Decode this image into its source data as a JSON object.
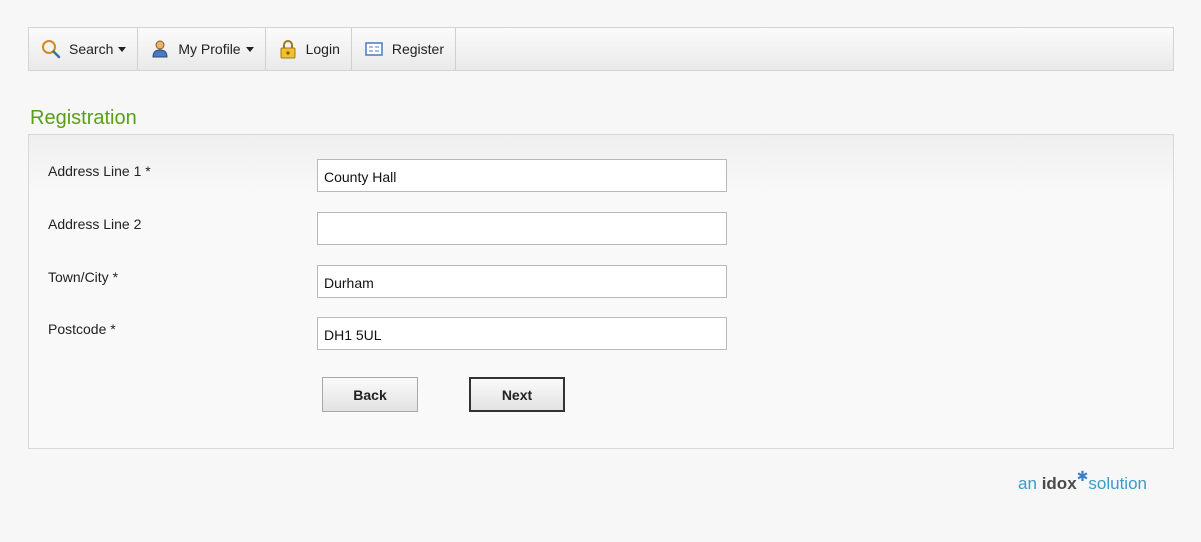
{
  "nav": {
    "items": [
      {
        "label": "Search",
        "icon": "search-icon",
        "dropdown": true
      },
      {
        "label": "My Profile",
        "icon": "user-icon",
        "dropdown": true
      },
      {
        "label": "Login",
        "icon": "lock-icon",
        "dropdown": false
      },
      {
        "label": "Register",
        "icon": "form-icon",
        "dropdown": false
      }
    ]
  },
  "page": {
    "title": "Registration"
  },
  "form": {
    "address_line_1": {
      "label": "Address Line 1 *",
      "value": "County Hall"
    },
    "address_line_2": {
      "label": "Address Line 2",
      "value": ""
    },
    "town_city": {
      "label": "Town/City *",
      "value": "Durham"
    },
    "postcode": {
      "label": "Postcode *",
      "value": "DH1 5UL"
    },
    "back_label": "Back",
    "next_label": "Next"
  },
  "footer": {
    "brand_prefix": "an",
    "brand_name": "idox",
    "brand_suffix": "solution"
  },
  "colors": {
    "title": "#5a9e16",
    "brand": "#3a9cc8"
  }
}
